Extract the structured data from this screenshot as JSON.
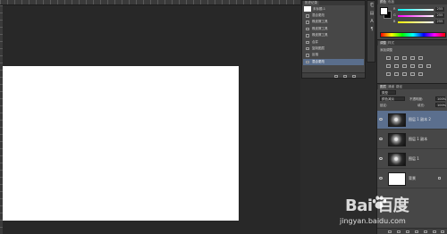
{
  "history": {
    "tab_label": "历史记录",
    "snapshot_label": "未标题-1",
    "items": [
      {
        "label": "混合更改"
      },
      {
        "label": "橡皮擦工具"
      },
      {
        "label": "橡皮擦工具"
      },
      {
        "label": "橡皮擦工具"
      },
      {
        "label": "合并"
      },
      {
        "label": "复制图层"
      },
      {
        "label": "反相"
      },
      {
        "label": "混合更改"
      }
    ],
    "active_index": 7
  },
  "color": {
    "tabs": [
      "颜色",
      "色板"
    ],
    "sliders": [
      {
        "label": "R",
        "value": "255"
      },
      {
        "label": "G",
        "value": "255"
      },
      {
        "label": "B",
        "value": "255"
      }
    ],
    "fg_color": "#ffffff",
    "bg_color": "#000000"
  },
  "adjustments": {
    "tabs": [
      "调整",
      "样式"
    ],
    "add_label": "添加调整"
  },
  "layers": {
    "tabs": [
      "图层",
      "通道",
      "路径"
    ],
    "kind_label": "类型",
    "blend_mode": "颜色减淡",
    "opacity_label": "不透明度:",
    "opacity_value": "100%",
    "lock_label": "锁定:",
    "fill_label": "填充:",
    "fill_value": "100%",
    "items": [
      {
        "name": "图层 1 副本 2",
        "thumb": "dark",
        "active": true
      },
      {
        "name": "图层 1 副本",
        "thumb": "dark",
        "active": false
      },
      {
        "name": "图层 1",
        "thumb": "dark",
        "active": false
      },
      {
        "name": "背景",
        "thumb": "white",
        "active": false,
        "locked": true
      }
    ]
  },
  "watermark": {
    "logo_text": "Bai  百度",
    "url": "jingyan.baidu.com"
  }
}
